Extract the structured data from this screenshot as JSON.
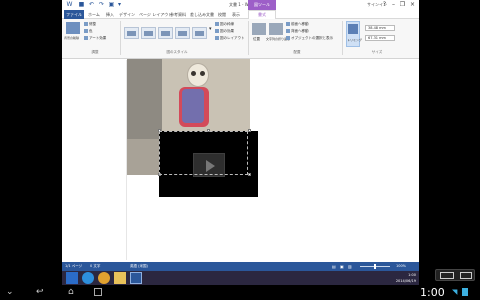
{
  "app": {
    "title": "文書 1 - Word",
    "context_group": "図ツール",
    "account": "サインイン"
  },
  "tabs": {
    "file": "ファイル",
    "items": [
      "ホーム",
      "挿入",
      "デザイン",
      "ページ レイアウト",
      "参考資料",
      "差し込み文書",
      "校閲",
      "表示"
    ],
    "format": "書式"
  },
  "ribbon": {
    "adjust_label": "調整",
    "styles_label": "図のスタイル",
    "arrange_label": "配置",
    "size_label": "サイズ",
    "remove_bg": "背景の削除",
    "corrections": "修整",
    "color": "色",
    "artistic": "アート効果",
    "border": "図の枠線",
    "effects": "図の効果",
    "layout": "図のレイアウト",
    "position": "位置",
    "wrap": "文字列の折り返し",
    "forward": "前面へ移動",
    "backward": "背面へ移動",
    "selection": "オブジェクトの選択と表示",
    "crop": "トリミング",
    "height": "38.48 mm",
    "width": "67.31 mm"
  },
  "status": {
    "page": "1/1 ページ",
    "words": "0 文字",
    "language": "英語 (米国)",
    "zoom": "100%"
  },
  "tray": {
    "time": "1:00",
    "date": "2014/06/19"
  },
  "android": {
    "clock": "1:00"
  }
}
